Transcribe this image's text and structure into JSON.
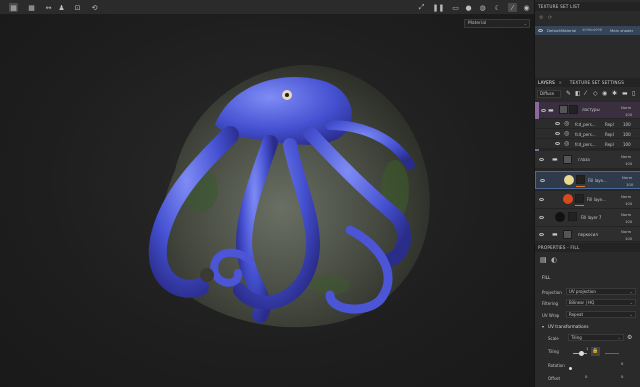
{
  "toolbar": {
    "left_icons": [
      "grid-2x2-icon",
      "grid-3x3-icon",
      "split-sync-icon",
      "person-icon",
      "frame-icon",
      "history-icon"
    ],
    "right_icons": [
      "fullscreen-icon",
      "pause-icon",
      "camera-icon",
      "sphere-icon",
      "globe-icon",
      "moon-icon",
      "brush-icon",
      "screenshot-icon"
    ]
  },
  "viewport": {
    "material_select": "Material"
  },
  "texture_set_list": {
    "title": "TEXTURE SET LIST",
    "item": {
      "name": "DefaultMaterial",
      "resolution": "4096x4096",
      "shader": "Main shader"
    }
  },
  "layers_panel": {
    "tabs": [
      "LAYERS",
      "TEXTURE SET SETTINGS"
    ],
    "channel": "Diffuse",
    "layers": [
      {
        "name": "ластуры",
        "blend": "Norm",
        "opacity": "100",
        "type": "folder"
      },
      {
        "name": "fcd_pers...",
        "blend": "Repl",
        "opacity": "100",
        "type": "sub"
      },
      {
        "name": "fcd_pers...",
        "blend": "Repl",
        "opacity": "100",
        "type": "sub"
      },
      {
        "name": "fcd_pers...",
        "blend": "Repl",
        "opacity": "100",
        "type": "sub"
      },
      {
        "name": "глаза",
        "blend": "Norm",
        "opacity": "100",
        "type": "folder"
      },
      {
        "name": "Fill laye...",
        "blend": "Norm",
        "opacity": "100",
        "type": "fill"
      },
      {
        "name": "Fill laye...",
        "blend": "Norm",
        "opacity": "100",
        "type": "fill"
      },
      {
        "name": "Fill layer 7",
        "blend": "Norm",
        "opacity": "100",
        "type": "fill"
      },
      {
        "name": "перкосил",
        "blend": "Norm",
        "opacity": "100",
        "type": "folder"
      }
    ]
  },
  "properties": {
    "title": "PROPERTIES - FILL",
    "section": "FILL",
    "projection_label": "Projection",
    "projection_value": "UV projection",
    "filtering_label": "Filtering",
    "filtering_value": "Bilinear | HQ",
    "uvwrap_label": "UV Wrap",
    "uvwrap_value": "Repeat",
    "uvt_label": "UV transformations",
    "scale_label": "Scale",
    "scale_value": "Tiling",
    "tiling_label": "Tiling",
    "tiling_value": "1",
    "rotation_label": "Rotation",
    "rotation_value": "0",
    "offset_label": "Offset",
    "offset_x": "0",
    "offset_y": "0"
  }
}
